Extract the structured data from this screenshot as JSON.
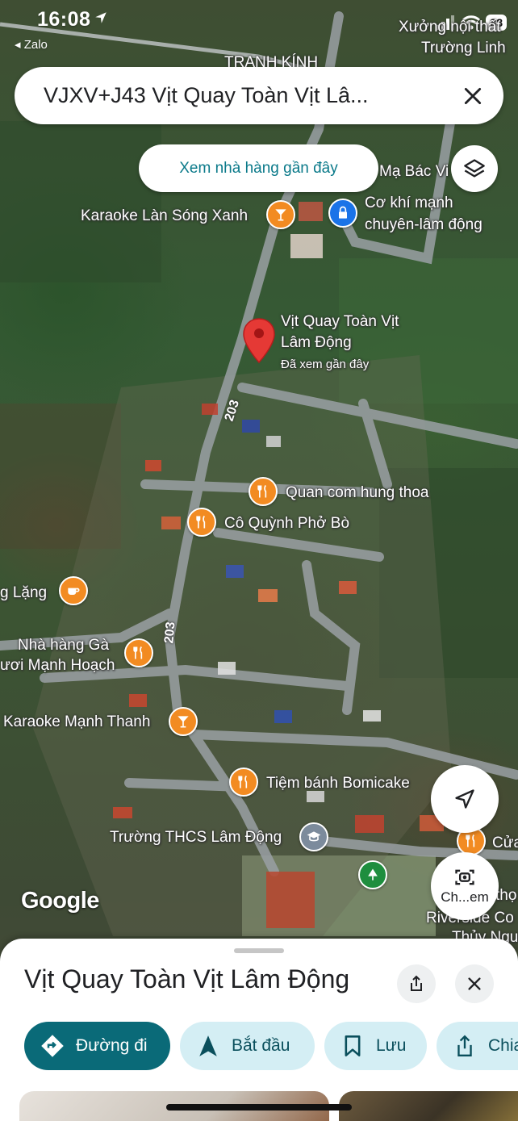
{
  "status_bar": {
    "time": "16:08",
    "back_label": "◂ Zalo",
    "battery": "88"
  },
  "search": {
    "query": "VJXV+J43 Vịt Quay Toàn Vịt Lâ..."
  },
  "nearby_chip": {
    "label": "Xem nhà hàng gần đây"
  },
  "map": {
    "labels": {
      "top_right_1": "Xưởng nội thất",
      "top_right_2": "Trường Linh",
      "tranh_kinh": "TRANH KÍNH",
      "ma_bac_vi": "Mạ Bác Vi",
      "karaoke_lan_song": "Karaoke Làn Sóng Xanh",
      "co_khi_1": "Cơ khí mạnh",
      "co_khi_2": "chuyên-lâm động",
      "pin_name_1": "Vịt Quay Toàn Vịt",
      "pin_name_2": "Lâm Động",
      "pin_sub": "Đã xem gần đây",
      "quan_com": "Quan com hung thoa",
      "co_quynh": "Cô Quỳnh Phở Bò",
      "lang": "g Lặng",
      "nha_hang_1": "Nhà hàng Gà",
      "nha_hang_2": "ươi Mạnh Hoạch",
      "karaoke_manh_thanh": "Karaoke Mạnh Thanh",
      "tiem_banh": "Tiệm bánh Bomicake",
      "truong_thcs": "Trường THCS Lâm Động",
      "cua": "Cửa",
      "tho": "thọ",
      "riverside": "Riverside Co",
      "thuy_ngu": "Thủy Ngu",
      "road_203": "203"
    },
    "google_logo": "Google"
  },
  "lens_button": {
    "label": "Ch...em"
  },
  "place": {
    "title": "Vịt Quay Toàn Vịt Lâm Động",
    "actions": [
      {
        "label": "Đường đi",
        "icon": "directions-icon"
      },
      {
        "label": "Bắt đầu",
        "icon": "navigate-icon"
      },
      {
        "label": "Lưu",
        "icon": "bookmark-icon"
      },
      {
        "label": "Chia",
        "icon": "share-icon"
      }
    ]
  },
  "colors": {
    "accent_teal": "#0a6a78",
    "chip_text": "#0b7a8a",
    "poi_orange": "#f28b22",
    "pin_red": "#e53935"
  }
}
